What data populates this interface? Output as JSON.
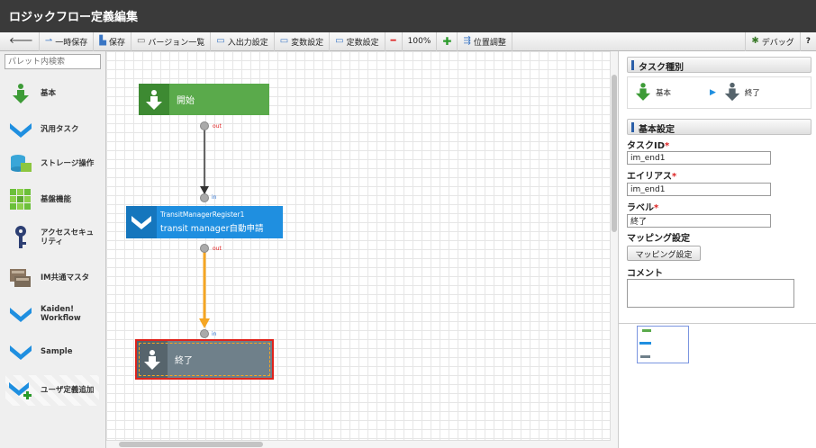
{
  "window": {
    "title": "ロジックフロー定義編集"
  },
  "toolbar": {
    "back_icon": "arrow-left-icon",
    "temp_save": "一時保存",
    "save": "保存",
    "versions": "バージョン一覧",
    "io_settings": "入出力設定",
    "var_settings": "変数設定",
    "const_settings": "定数設定",
    "zoom": "100%",
    "position": "位置調整",
    "debug": "デバッグ",
    "help": "?"
  },
  "palette": {
    "search_placeholder": "パレット内検索",
    "items": [
      {
        "label": "基本",
        "icon": "arrow-down-green-icon"
      },
      {
        "label": "汎用タスク",
        "icon": "arrow-down-blue-icon"
      },
      {
        "label": "ストレージ操作",
        "icon": "storage-icon"
      },
      {
        "label": "基盤機能",
        "icon": "grid-blocks-icon"
      },
      {
        "label": "アクセスセキュリティ",
        "icon": "key-icon"
      },
      {
        "label": "IM共通マスタ",
        "icon": "master-icon"
      },
      {
        "label": "Kaiden! Workflow",
        "icon": "arrow-down-blue-icon"
      },
      {
        "label": "Sample",
        "icon": "arrow-down-blue-icon"
      },
      {
        "label": "ユーザ定義追加",
        "icon": "arrow-down-plus-icon"
      }
    ]
  },
  "canvas": {
    "nodes": {
      "start": {
        "label": "開始",
        "color": "#5aaa4b"
      },
      "task": {
        "id": "TransitManagerRegister1",
        "label": "transit manager自動申請",
        "color": "#1f8fe0"
      },
      "end": {
        "label": "終了",
        "color": "#6f808a"
      }
    },
    "port_out": "out",
    "port_in": "in",
    "colors": {
      "edge_default": "#333333",
      "edge_selected": "#f5a623",
      "selection": "#e0231c"
    }
  },
  "props": {
    "task_type": {
      "heading": "タスク種別",
      "category": "基本",
      "type": "終了"
    },
    "basic": {
      "heading": "基本設定",
      "task_id_label": "タスクID",
      "task_id_value": "im_end1",
      "alias_label": "エイリアス",
      "alias_value": "im_end1",
      "label_label": "ラベル",
      "label_value": "終了",
      "mapping_label": "マッピング設定",
      "mapping_button": "マッピング設定",
      "comment_label": "コメント",
      "comment_value": "",
      "required_mark": "*"
    }
  }
}
